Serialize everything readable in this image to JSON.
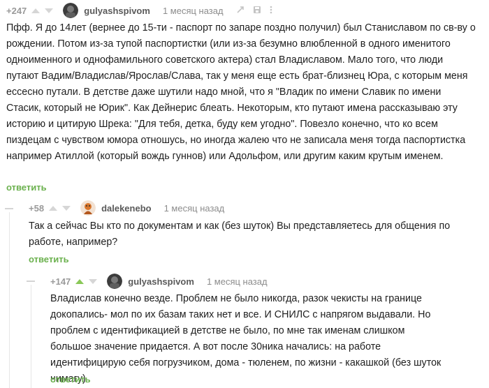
{
  "comments": [
    {
      "rating": "+247",
      "author": "gulyashspivom",
      "time": "1 месяц назад",
      "text": "Пфф. Я до 14лет (вернее до 15-ти - паспорт по запаре поздно получил) был Станиславом по св-ву о рождении. Потом из-за тупой паспортистки (или из-за безумно влюбленной в одного именитого одноименного и однофамильного советского актера) стал Владиславом. Мало того, что люди путают Вадим/Владислав/Ярослав/Слава, так у меня еще есть брат-близнец Юра, с которым меня ессесно путали. В детстве даже шутили надо мной, что я \"Владик по имени Славик по имени Стасик, который не Юрик\". Как Дейнерис блеать. Некоторым, кто путают имена рассказываю эту историю и цитирую Шрека: \"Для тебя, детка, буду кем угодно\". Повезло конечно, что ко всем пиздецам с чувством юмора отношусь, но иногда жалею что не записала меня тогда паспортистка например Атиллой (который вождь гуннов) или Адольфом, или другим каким крутым именем.",
      "reply": "ответить"
    },
    {
      "rating": "+58",
      "author": "dalekenebo",
      "time": "1 месяц назад",
      "text": "Так а сейчас Вы кто по документам и как (без шуток) Вы представляетесь для общения по работе, например?",
      "reply": "ответить"
    },
    {
      "rating": "+147",
      "author": "gulyashspivom",
      "time": "1 месяц назад",
      "text": "Владислав конечно везде. Проблем не было никогда, разок чекисты на границе докопались- мол по их базам таких нет и все. И СНИЛС с напрягом выдавали. Но проблем с идентификацией в детстве не было, по мне так именам слишком большое значение придается. А вот после 30ника начались: на работе идентифицирую себя погрузчиком, дома - тюленем, по жизни - какашкой (без шуток нимагу)",
      "reply": "ответить"
    }
  ],
  "icons": [
    "upvote-icon",
    "downvote-icon",
    "link-icon",
    "save-icon",
    "more-icon",
    "collapse-icon"
  ],
  "colors": {
    "reply": "#6bb14e",
    "upvote_active": "#8ac858",
    "muted": "#9a9a9a"
  }
}
